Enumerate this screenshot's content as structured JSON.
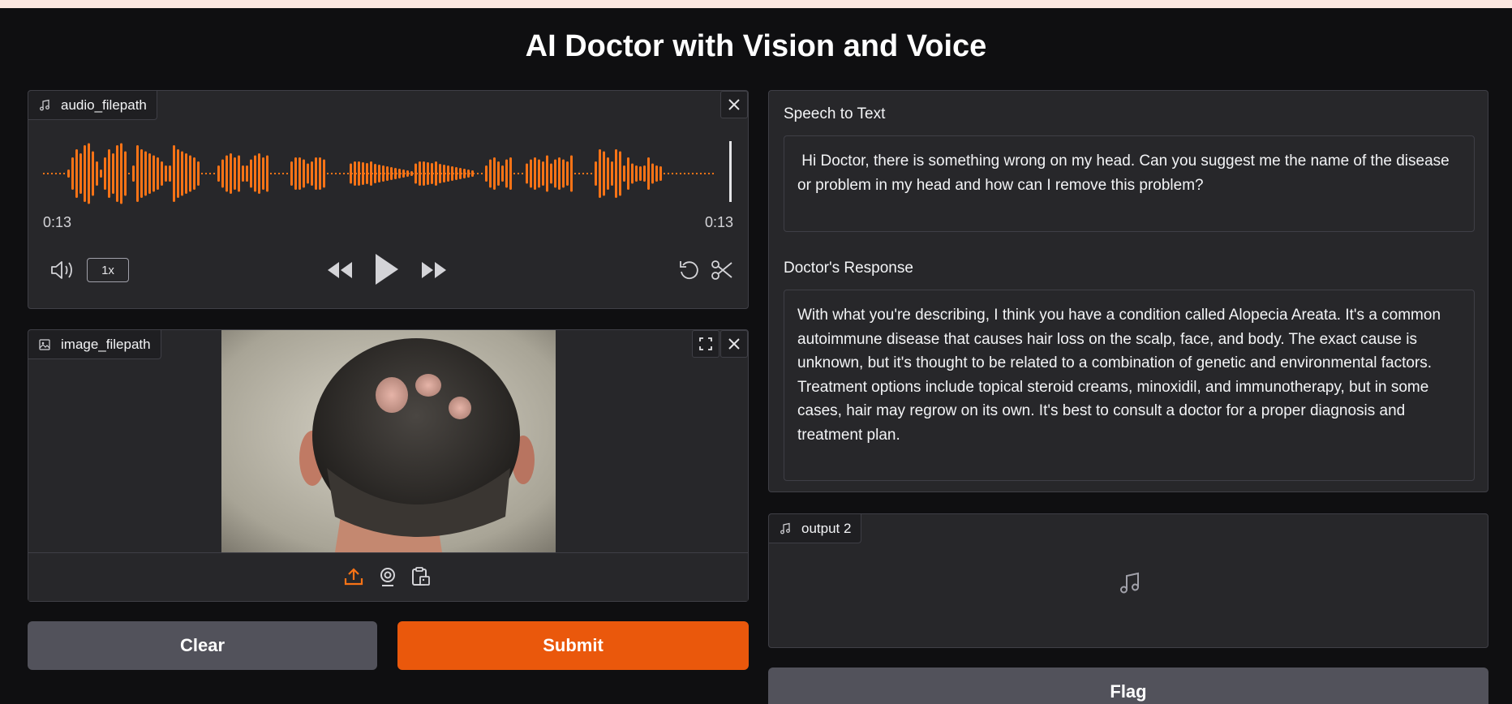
{
  "page": {
    "title": "AI Doctor with Vision and Voice"
  },
  "audio_input": {
    "label": "audio_filepath",
    "time_current": "0:13",
    "time_total": "0:13",
    "speed": "1x",
    "waveform_color": "#f97316"
  },
  "image_input": {
    "label": "image_filepath"
  },
  "buttons": {
    "clear": "Clear",
    "submit": "Submit",
    "flag": "Flag"
  },
  "speech_to_text": {
    "label": "Speech to Text",
    "value": " Hi Doctor, there is something wrong on my head. Can you suggest me the name of the disease or problem in my head and how can I remove this problem?"
  },
  "doctor_response": {
    "label": "Doctor's Response",
    "value": "With what you're describing, I think you have a condition called Alopecia Areata. It's a common autoimmune disease that causes hair loss on the scalp, face, and body. The exact cause is unknown, but it's thought to be related to a combination of genetic and environmental factors. Treatment options include topical steroid creams, minoxidil, and immunotherapy, but in some cases, hair may regrow on its own. It's best to consult a doctor for a proper diagnosis and treatment plan."
  },
  "audio_output": {
    "label": "output 2"
  },
  "colors": {
    "accent": "#ea580c",
    "background": "#0f0f11",
    "panel": "#27272a"
  }
}
